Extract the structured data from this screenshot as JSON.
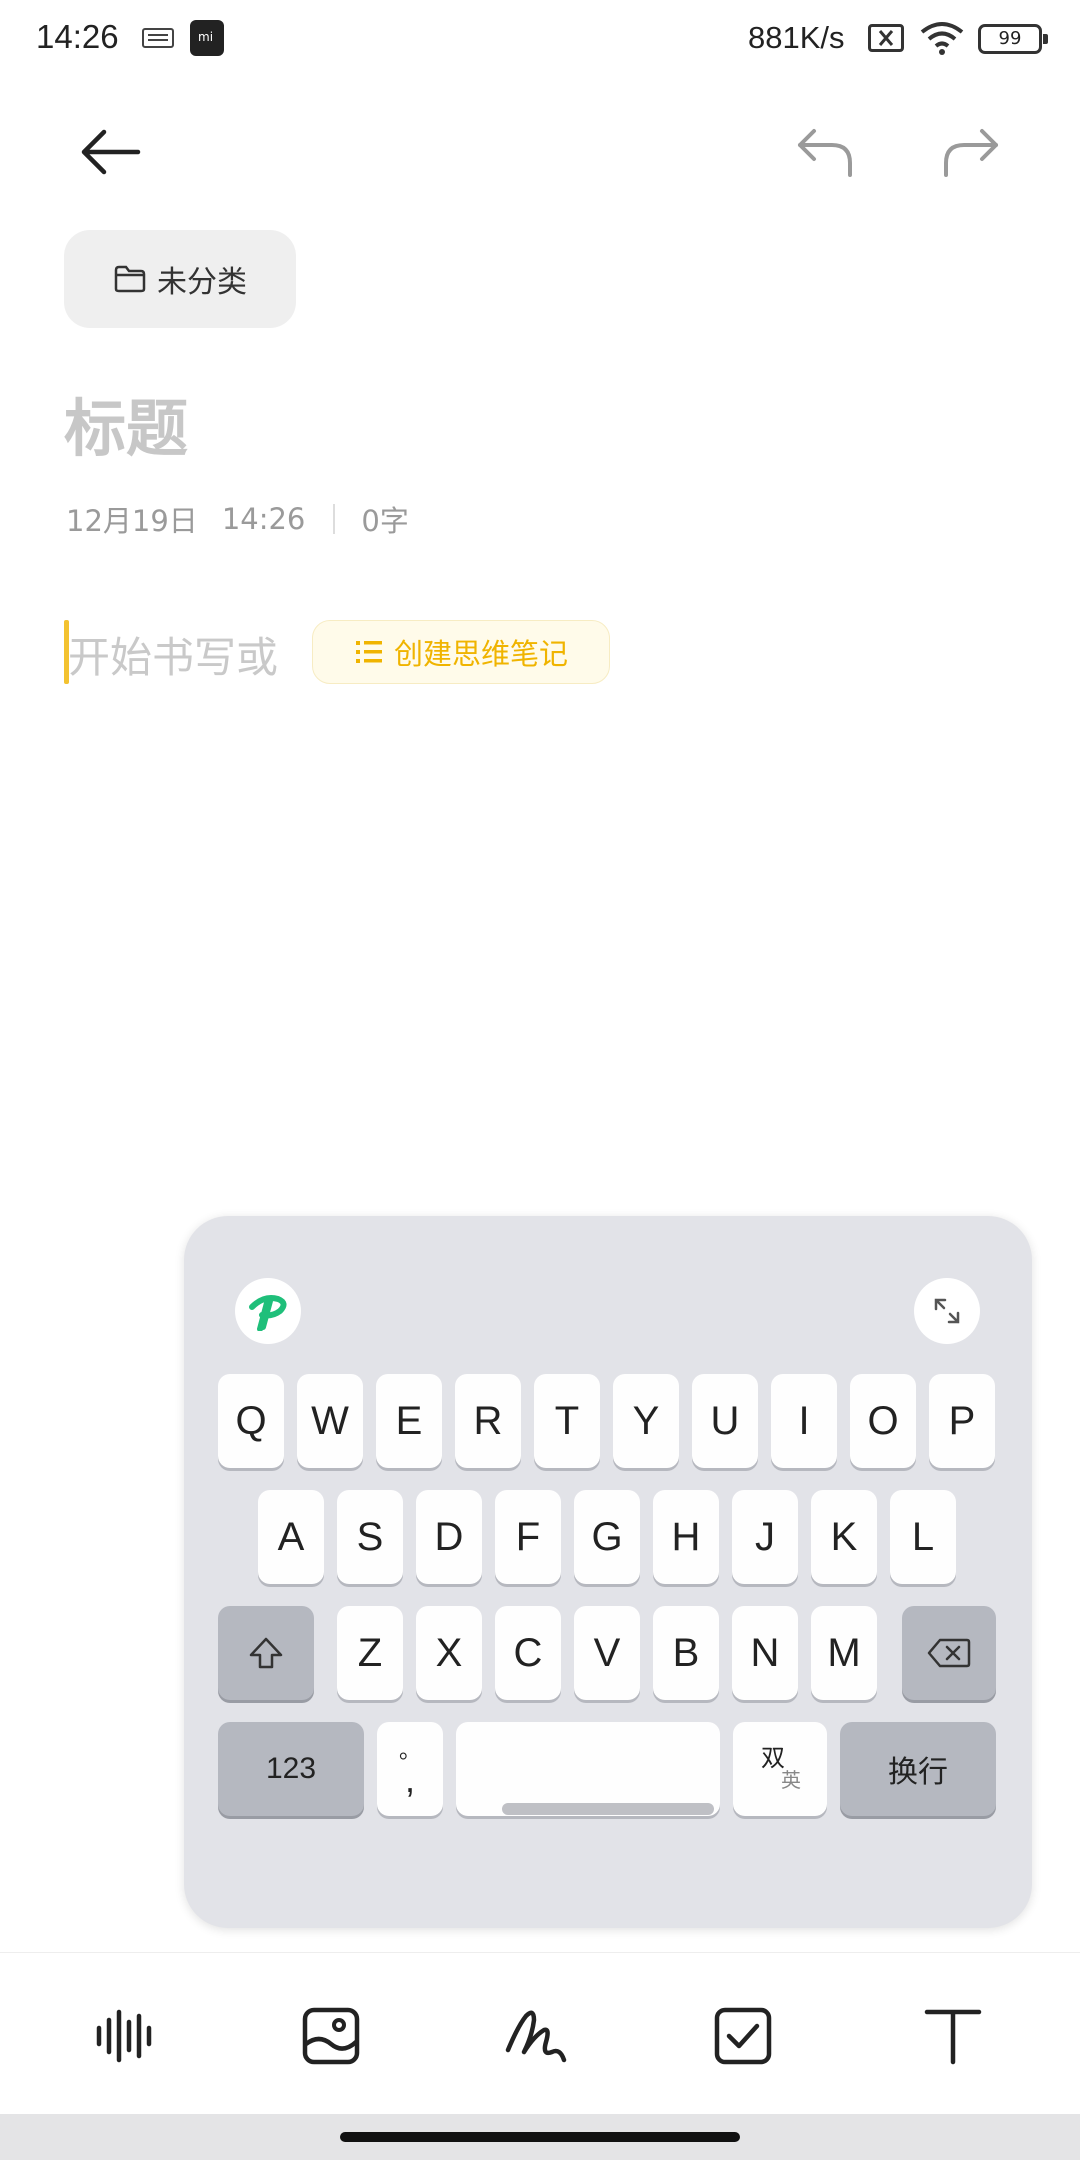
{
  "status_bar": {
    "time": "14:26",
    "net_speed": "881K/s",
    "battery": "99",
    "icons": [
      "keyboard-icon",
      "mi-store-icon",
      "sim-off-icon",
      "wifi-icon",
      "battery-icon"
    ]
  },
  "nav": {
    "icons": [
      "back-arrow-icon",
      "undo-icon",
      "redo-icon"
    ]
  },
  "category": {
    "label": "未分类",
    "icon": "folder-icon"
  },
  "note": {
    "title_placeholder": "标题",
    "date": "12月19日",
    "time": "14:26",
    "word_count": "0字",
    "body_placeholder": "开始书写或",
    "mindmap_label": "创建思维笔记"
  },
  "keyboard": {
    "row1": [
      "Q",
      "W",
      "E",
      "R",
      "T",
      "Y",
      "U",
      "I",
      "O",
      "P"
    ],
    "row2": [
      "A",
      "S",
      "D",
      "F",
      "G",
      "H",
      "J",
      "K",
      "L"
    ],
    "row3": [
      "Z",
      "X",
      "C",
      "V",
      "B",
      "N",
      "M"
    ],
    "numbers_key": "123",
    "punct_top": "。",
    "punct_bottom": ",",
    "lang_top": "双",
    "lang_bottom": "英",
    "enter_key": "换行",
    "icons": [
      "keyboard-logo-icon",
      "expand-icon",
      "shift-icon",
      "backspace-icon"
    ]
  },
  "toolbar": {
    "icons": [
      "voice-icon",
      "image-icon",
      "handwriting-icon",
      "checkbox-icon",
      "text-format-icon"
    ]
  },
  "colors": {
    "accent": "#f0b400",
    "caret": "#f3c230",
    "keyboard_bg": "#e2e3e8",
    "key_dark": "#b5b8c0",
    "logo_green": "#1fbf7a"
  }
}
